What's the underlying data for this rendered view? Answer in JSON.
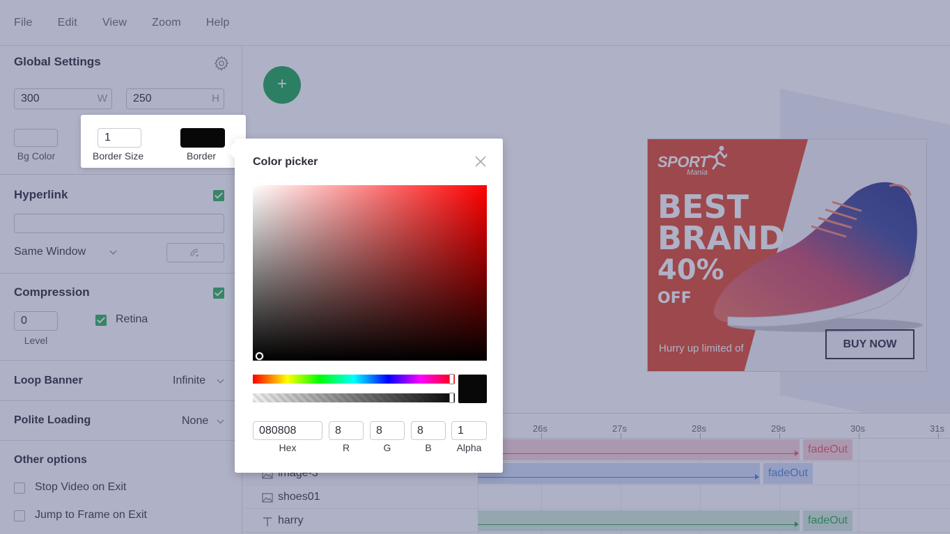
{
  "menu": [
    "File",
    "Edit",
    "View",
    "Zoom",
    "Help"
  ],
  "sidebar": {
    "global_title": "Global Settings",
    "width_value": "300",
    "width_suffix": "W",
    "height_value": "250",
    "height_suffix": "H",
    "bg_color_label": "Bg Color",
    "hyperlink_title": "Hyperlink",
    "hyperlink_value": "",
    "same_window": "Same Window",
    "compression_title": "Compression",
    "level_value": "0",
    "level_label": "Level",
    "retina_label": "Retina",
    "loop_title": "Loop Banner",
    "loop_value": "Infinite",
    "polite_title": "Polite Loading",
    "polite_value": "None",
    "other_title": "Other options",
    "stop_video": "Stop Video on Exit",
    "jump_frame": "Jump to Frame on Exit"
  },
  "border_popup": {
    "size_value": "1",
    "size_label": "Border Size",
    "border_label": "Border",
    "border_color": "#080808"
  },
  "color_picker": {
    "title": "Color picker",
    "hex_value": "080808",
    "r_value": "8",
    "g_value": "8",
    "b_value": "8",
    "alpha_value": "1",
    "hex_label": "Hex",
    "r_label": "R",
    "g_label": "G",
    "b_label": "B",
    "alpha_label": "Alpha"
  },
  "banner": {
    "logo": "SPORT",
    "logo_sub": "Mania",
    "line1": "BEST",
    "line2": "BRAND",
    "line3": "40%",
    "line4": "OFF",
    "hurry": "Hurry up limited of",
    "buy": "BUY NOW"
  },
  "timeline": {
    "ticks": [
      "26s",
      "27s",
      "28s",
      "29s",
      "30s",
      "31s"
    ],
    "layers": [
      {
        "name": "",
        "effect": "fadeOut",
        "color": "#e35a67"
      },
      {
        "name": "image-3",
        "effect": "fadeOut",
        "color": "#4f86d8"
      },
      {
        "name": "shoes01",
        "effect": "",
        "color": ""
      },
      {
        "name": "harry",
        "effect": "fadeOut",
        "color": "#2ea653"
      }
    ]
  },
  "colors": {
    "accent_green": "#1fa955",
    "overlay": "#40447a"
  }
}
